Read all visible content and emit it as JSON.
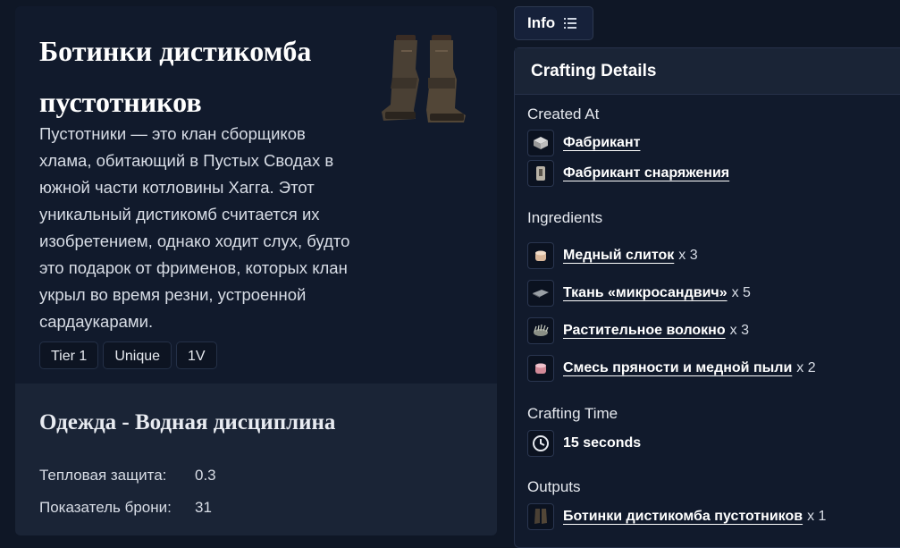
{
  "item": {
    "title": "Ботинки дистикомба пустотников",
    "image_icon": "boots-icon",
    "description": "Пустотники — это клан сборщиков хлама, обитающий в Пустых Сводах в южной части котловины Хагга. Этот уникальный дистикомб считается их изобретением, однако ходит слух, будто это подарок от фрименов, которых клан укрыл во время резни, устроенной сардаукарами.",
    "tags": [
      "Tier 1",
      "Unique",
      "1V"
    ]
  },
  "stats": {
    "title": "Одежда - Водная дисциплина",
    "rows": [
      {
        "label": "Тепловая защита:",
        "value": "0.3"
      },
      {
        "label": "Показатель брони:",
        "value": "31"
      }
    ]
  },
  "info_tab": {
    "label": "Info",
    "icon": "list-icon"
  },
  "crafting": {
    "header": "Crafting Details",
    "created_at_label": "Created At",
    "created_at": [
      {
        "name": "Фабрикант",
        "icon": "fabricator-icon"
      },
      {
        "name": "Фабрикант снаряжения",
        "icon": "gear-fabricator-icon"
      }
    ],
    "ingredients_label": "Ingredients",
    "ingredients": [
      {
        "name": "Медный слиток",
        "qty": "x 3",
        "icon": "copper-ingot-icon"
      },
      {
        "name": "Ткань «микросандвич»",
        "qty": "x 5",
        "icon": "fabric-icon"
      },
      {
        "name": "Растительное волокно",
        "qty": "x 3",
        "icon": "plant-fiber-icon"
      },
      {
        "name": "Смесь пряности и медной пыли",
        "qty": "x 2",
        "icon": "spice-mix-icon"
      }
    ],
    "time_label": "Crafting Time",
    "time_value": "15 seconds",
    "outputs_label": "Outputs",
    "outputs": [
      {
        "name": "Ботинки дистикомба пустотников",
        "qty": "x 1",
        "icon": "boots-icon"
      }
    ]
  },
  "colors": {
    "background": "#0f1726",
    "card": "#111a2c",
    "section": "#1a2436"
  }
}
